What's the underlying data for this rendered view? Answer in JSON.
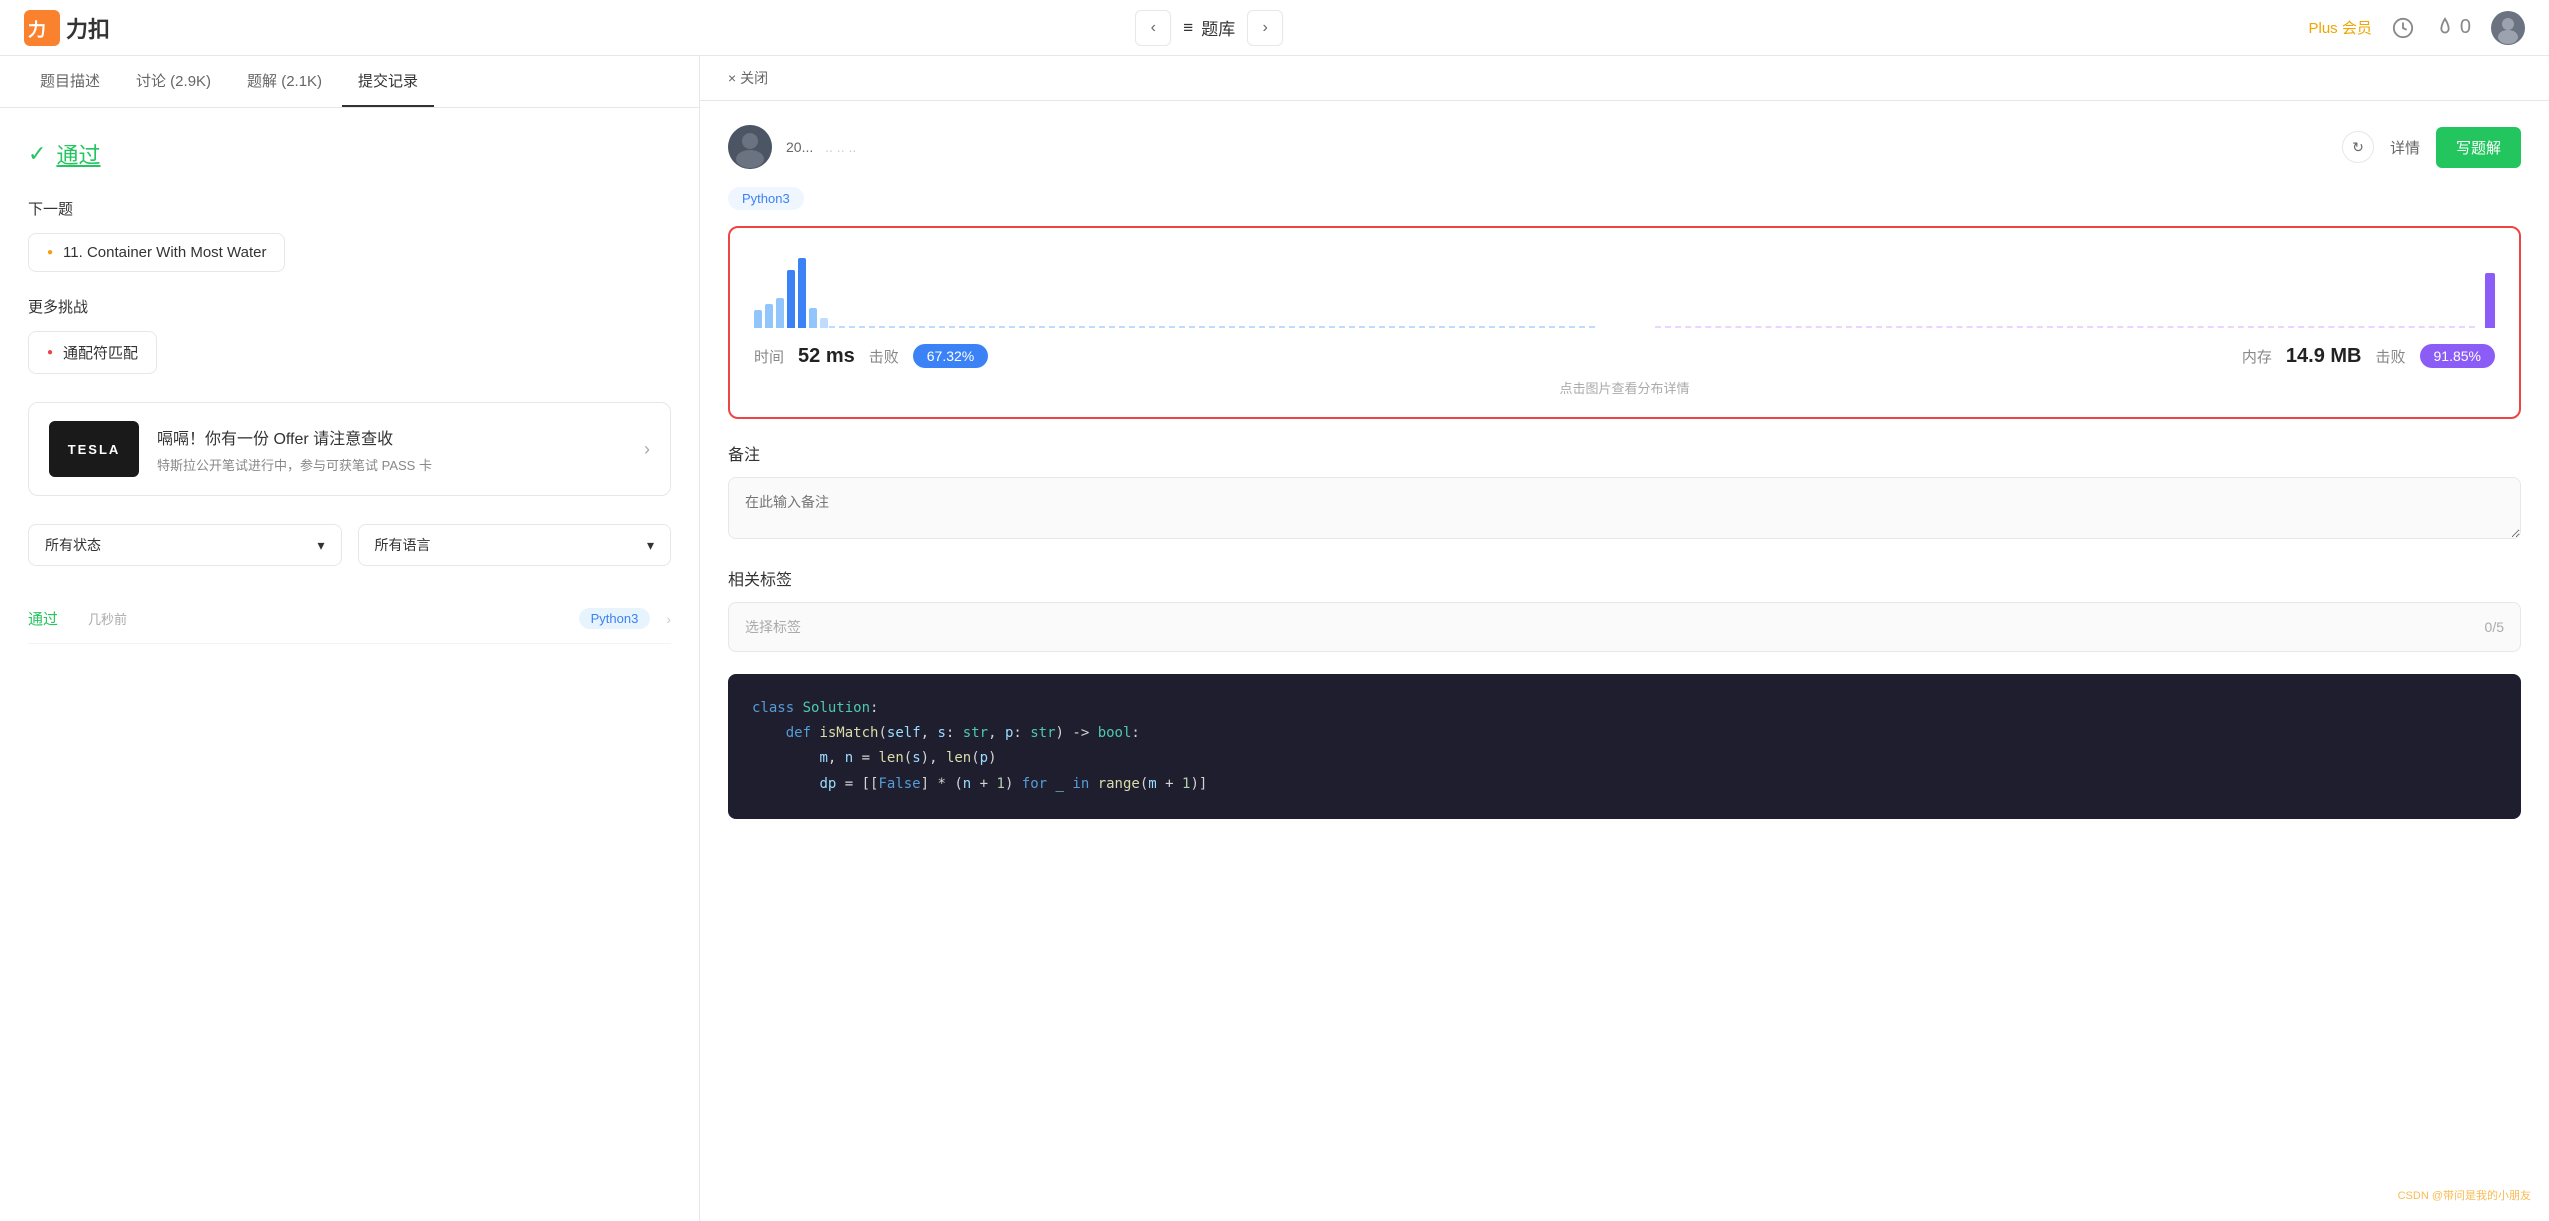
{
  "app": {
    "logo_text": "力扣",
    "header": {
      "prev_label": "‹",
      "menu_label": "≡",
      "nav_title": "题库",
      "next_label": "›",
      "plus_label": "Plus 会员",
      "fire_count": "0"
    }
  },
  "left": {
    "tabs": [
      {
        "id": "description",
        "label": "题目描述",
        "active": false
      },
      {
        "id": "discuss",
        "label": "讨论 (2.9K)",
        "active": false
      },
      {
        "id": "solutions",
        "label": "题解 (2.1K)",
        "active": false
      },
      {
        "id": "submissions",
        "label": "提交记录",
        "active": true
      }
    ],
    "pass_text": "通过",
    "next_problem_label": "下一题",
    "next_problem": {
      "dot_color": "orange",
      "title": "11. Container With Most Water"
    },
    "more_challenges_label": "更多挑战",
    "challenge": {
      "dot_color": "red",
      "title": "通配符匹配"
    },
    "ad": {
      "logo_text": "TESLA",
      "title": "嗝嗝！你有一份 Offer 请注意查收",
      "desc": "特斯拉公开笔试进行中，参与可获笔试 PASS 卡"
    },
    "filters": {
      "status": {
        "label": "所有状态",
        "placeholder": "所有状态"
      },
      "language": {
        "label": "所有语言",
        "placeholder": "所有语言"
      }
    },
    "submission": {
      "status": "通过",
      "time": "几秒前",
      "language": "Python3"
    }
  },
  "right": {
    "close_label": "× 关闭",
    "user": {
      "name": "20...",
      "meta": ".. .. .."
    },
    "refresh_label": "↻",
    "detail_label": "详情",
    "write_solution_label": "写题解",
    "lang_badge": "Python3",
    "perf": {
      "time_label": "时间",
      "time_value": "52 ms",
      "defeat_label": "击败",
      "defeat_time_pct": "67.32%",
      "memory_label": "内存",
      "memory_value": "14.9 MB",
      "defeat_mem_label": "击败",
      "defeat_mem_pct": "91.85%",
      "footer": "点击图片查看分布详情"
    },
    "notes": {
      "section_title": "备注",
      "placeholder": "在此输入备注"
    },
    "tags": {
      "section_title": "相关标签",
      "placeholder": "选择标签",
      "count": "0/5"
    },
    "code": [
      {
        "text": "class Solution:",
        "type": "class"
      },
      {
        "text": "    def isMatch(self, s: str, p: str) -> bool:",
        "type": "def"
      },
      {
        "text": "        m, n = len(s), len(p)",
        "type": "plain"
      },
      {
        "text": "        dp = [[False] * (n + 1) for _ in range(m + 1)]",
        "type": "plain"
      }
    ]
  },
  "watermark": "CSDN @带问是我的小朋友"
}
